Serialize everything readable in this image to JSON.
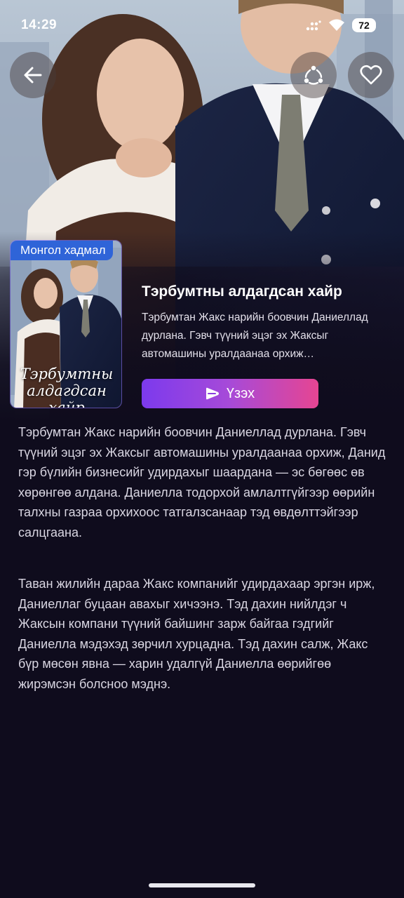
{
  "status_bar": {
    "time": "14:29",
    "battery": "72"
  },
  "header": {
    "back_icon": "arrow-left-icon",
    "share_icon": "share-icon",
    "favorite_icon": "heart-icon"
  },
  "drama": {
    "badge": "Монгол хадмал",
    "cover_title": "Тэрбумтны алдагдсан хайр",
    "title": "Тэрбумтны алдагдсан хайр",
    "short_description": "Тэрбумтан Жакс нарийн боовчин Даниеллад дурлана. Гэвч түүний эцэг эх Жаксыг автомашины уралдаанаа орхиж…",
    "watch_label": "Үзэх",
    "watch_icon": "play-icon"
  },
  "description": {
    "paragraph_1": "Тэрбумтан Жакс нарийн боовчин Даниеллад дурлана. Гэвч түүний эцэг эх Жаксыг автомашины уралдаанаа орхиж, Данид гэр бүлийн бизнесийг удирдахыг шаардана — эс бөгөөс өв хөрөнгөө алдана. Даниелла тодорхой амлалтгүйгээр өөрийн талхны газраа орхихоос татгалзсанаар тэд өвдөлттэйгээр салцгаана.",
    "paragraph_2": "Таван жилийн дараа Жакс компанийг удирдахаар эргэн ирж, Даниеллаг буцаан авахыг хичээнэ. Тэд дахин нийлдэг ч Жаксын компани түүний байшинг зарж байгаа гэдгийг Даниелла мэдэхэд зөрчил хурцадна. Тэд дахин салж, Жакс бүр мөсөн явна — харин удалгүй Даниелла өөрийгөө жирэмсэн болсноо мэднэ."
  },
  "colors": {
    "background": "#0f0c1d",
    "badge": "#2f64d8",
    "button_start": "#7c3aed",
    "button_end": "#e64592"
  }
}
